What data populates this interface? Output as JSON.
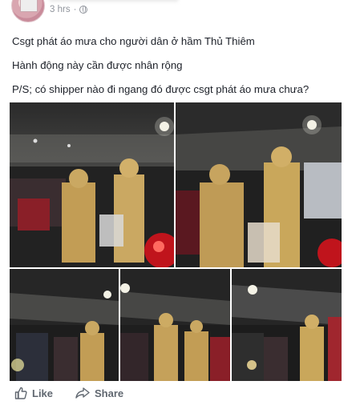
{
  "post": {
    "timestamp": "3 hrs",
    "lines": [
      "Csgt phát áo mưa cho người dân ở hầm Thủ Thiêm",
      "Hành động này cần được nhân rộng",
      "P/S; có shipper nào đi ngang đó được csgt phát áo mưa chưa?"
    ],
    "photos": [
      {
        "icon": "photo-tunnel-police-1"
      },
      {
        "icon": "photo-tunnel-police-2"
      },
      {
        "icon": "photo-tunnel-crowd-3"
      },
      {
        "icon": "photo-tunnel-crowd-4"
      },
      {
        "icon": "photo-tunnel-crowd-5"
      }
    ]
  },
  "actions": {
    "like_label": "Like",
    "share_label": "Share"
  },
  "colors": {
    "text": "#1d2129",
    "meta": "#90949c",
    "action": "#606770",
    "uniform": "#c9a75b"
  }
}
